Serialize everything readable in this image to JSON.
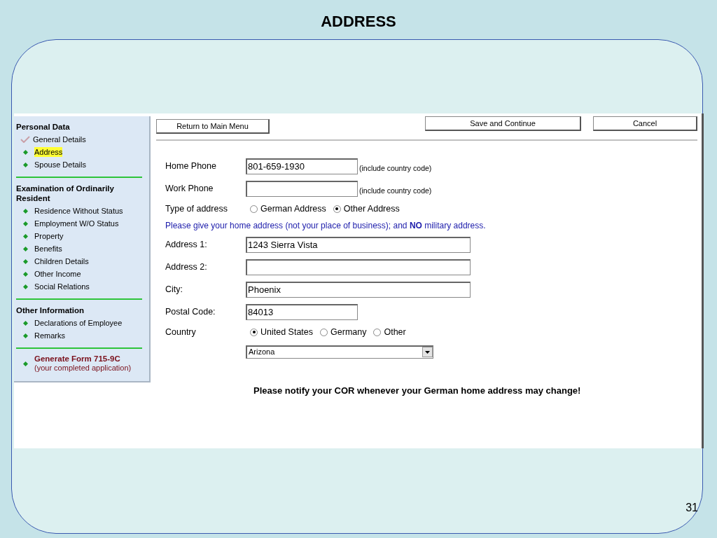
{
  "slide": {
    "title": "ADDRESS",
    "page_number": "31"
  },
  "sidebar": {
    "sections": [
      {
        "title": "Personal Data",
        "items": [
          {
            "label": "General Details",
            "kind": "done",
            "selected": false
          },
          {
            "label": "Address",
            "kind": "bullet",
            "selected": true
          },
          {
            "label": "Spouse Details",
            "kind": "bullet",
            "selected": false
          }
        ]
      },
      {
        "title": "Examination of Ordinarily Resident",
        "items": [
          {
            "label": "Residence Without Status",
            "kind": "bullet",
            "selected": false
          },
          {
            "label": "Employment W/O Status",
            "kind": "bullet",
            "selected": false
          },
          {
            "label": "Property",
            "kind": "bullet",
            "selected": false
          },
          {
            "label": "Benefits",
            "kind": "bullet",
            "selected": false
          },
          {
            "label": "Children Details",
            "kind": "bullet",
            "selected": false
          },
          {
            "label": "Other Income",
            "kind": "bullet",
            "selected": false
          },
          {
            "label": "Social Relations",
            "kind": "bullet",
            "selected": false
          }
        ]
      },
      {
        "title": "Other Information",
        "items": [
          {
            "label": "Declarations of Employee",
            "kind": "bullet",
            "selected": false
          },
          {
            "label": "Remarks",
            "kind": "bullet",
            "selected": false
          }
        ]
      }
    ],
    "action": {
      "label": "Generate Form 715-9C",
      "sublabel": "(your completed application)"
    }
  },
  "toolbar": {
    "left": [
      "Return to Main Menu"
    ],
    "right": [
      "Save and Continue",
      "Cancel"
    ]
  },
  "form": [
    {
      "kind": "short_text",
      "label": "Home Phone",
      "value": "801-659-1930",
      "hint": "(include country code)"
    },
    {
      "kind": "short_text",
      "label": "Work Phone",
      "hint": "(include country code)"
    },
    {
      "kind": "radio",
      "label": "Type of address",
      "options": [
        {
          "label": "German Address",
          "selected": false
        },
        {
          "label": "Other Address",
          "selected": true
        }
      ]
    },
    {
      "kind": "note",
      "text": "Please give your home address (not your place of business); and **NO** military address."
    },
    {
      "kind": "long_text",
      "label": "Address 1:",
      "value": "1243 Sierra Vista"
    },
    {
      "kind": "long_text",
      "label": "Address 2:"
    },
    {
      "kind": "long_text",
      "label": "City:",
      "value": "Phoenix"
    },
    {
      "kind": "short_text",
      "label": "Postal Code:",
      "value": "84013"
    },
    {
      "kind": "radio",
      "label": "Country",
      "options": [
        {
          "label": "United States",
          "selected": true
        },
        {
          "label": "Germany",
          "selected": false
        },
        {
          "label": "Other",
          "selected": false
        }
      ]
    },
    {
      "kind": "select",
      "value": "Arizona"
    }
  ],
  "notice": "Please notify your COR whenever your German home address may change!"
}
